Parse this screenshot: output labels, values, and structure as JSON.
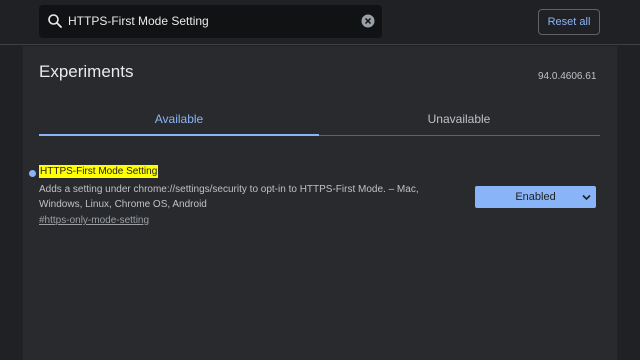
{
  "search": {
    "query": "HTTPS-First Mode Setting"
  },
  "toolbar": {
    "reset_label": "Reset all"
  },
  "page": {
    "title": "Experiments",
    "version": "94.0.4606.61"
  },
  "tabs": [
    {
      "label": "Available",
      "selected": true
    },
    {
      "label": "Unavailable",
      "selected": false
    }
  ],
  "experiment": {
    "name": "HTTPS-First Mode Setting",
    "description": "Adds a setting under chrome://settings/security to opt-in to HTTPS-First Mode. – Mac, Windows, Linux, Chrome OS, Android",
    "link": "#https-only-mode-setting",
    "selected_option": "Enabled"
  },
  "colors": {
    "accent": "#8ab4f8",
    "highlight": "#ffff00",
    "background": "#202124",
    "panel": "#292a2d"
  }
}
